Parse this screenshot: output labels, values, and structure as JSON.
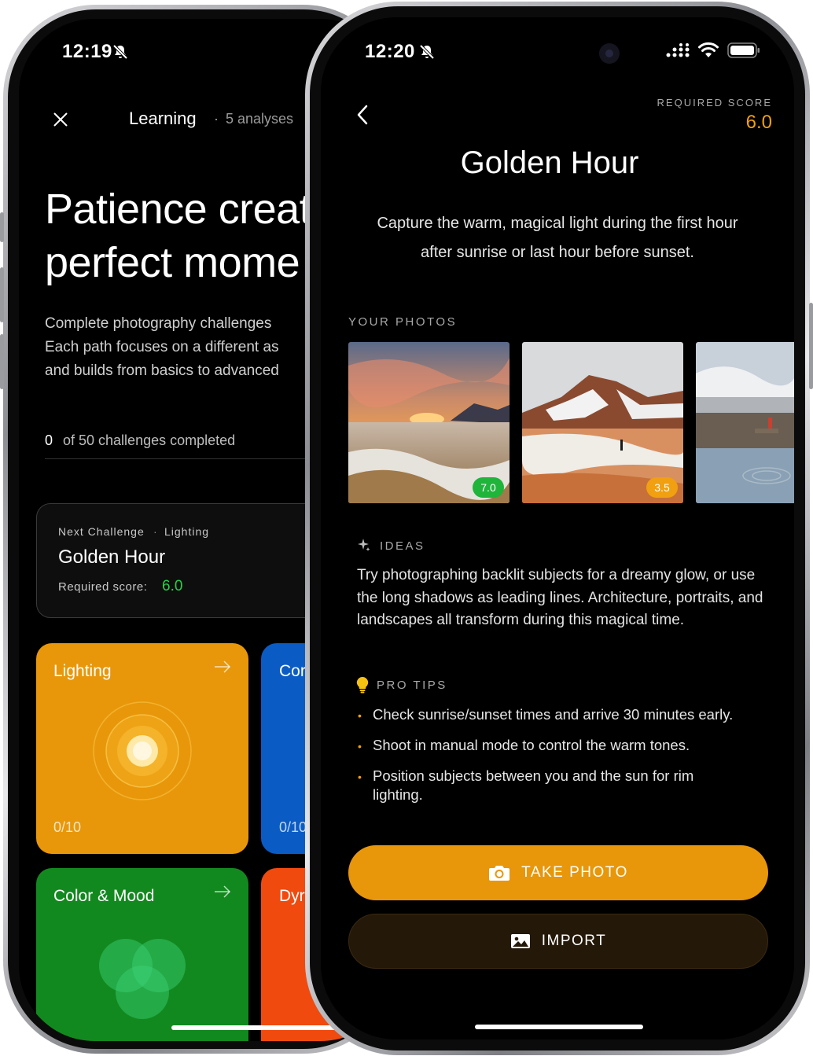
{
  "back_phone": {
    "status_time": "12:19",
    "header": {
      "title": "Learning",
      "separator": "·",
      "meta": "5 analyses"
    },
    "hero_line1": "Patience creat",
    "hero_line2": "perfect mome",
    "description": [
      "Complete photography challenges",
      "Each path focuses on a different as",
      "and builds from basics to advanced"
    ],
    "progress": {
      "count": "0",
      "text": "of 50 challenges completed"
    },
    "next_challenge": {
      "label": "Next Challenge",
      "dot": "·",
      "category": "Lighting",
      "title": "Golden Hour",
      "required_label": "Required score:",
      "required_value": "6.0"
    },
    "tiles": [
      {
        "title": "Lighting",
        "count": "0/10",
        "color": "#E8970A",
        "icon": "sun-rings-icon"
      },
      {
        "title": "Cor",
        "count": "0/10",
        "color": "#0A5CC4",
        "icon": "arrow-right-icon"
      },
      {
        "title": "Color & Mood",
        "color": "#12891E",
        "icon": "overlapping-circles-icon"
      },
      {
        "title": "Dyr",
        "color": "#F04A0E"
      }
    ]
  },
  "front_phone": {
    "status_time": "12:20",
    "required_score": {
      "label": "REQUIRED SCORE",
      "value": "6.0"
    },
    "title": "Golden Hour",
    "subtitle_line1": "Capture the warm, magical light during the first hour",
    "subtitle_line2": "after sunrise or last hour before sunset.",
    "photos_label": "YOUR PHOTOS",
    "photos": [
      {
        "score": "7.0",
        "badge_color": "#1FB43A"
      },
      {
        "score": "3.5",
        "badge_color": "#F0A010"
      },
      {
        "score": ""
      }
    ],
    "ideas": {
      "label": "IDEAS",
      "text": "Try photographing backlit subjects for a dreamy glow, or use the long shadows as leading lines. Architecture, portraits, and landscapes all transform during this magical time."
    },
    "pro_tips": {
      "label": "PRO TIPS",
      "items": [
        "Check sunrise/sunset times and arrive 30 minutes early.",
        "Shoot in manual mode to control the warm tones.",
        "Position subjects between you and the sun for rim lighting."
      ]
    },
    "buttons": {
      "take_photo": "TAKE PHOTO",
      "import": "IMPORT"
    },
    "colors": {
      "accent": "#E8970A",
      "import_bg": "#241808",
      "success": "#1FB43A"
    }
  }
}
